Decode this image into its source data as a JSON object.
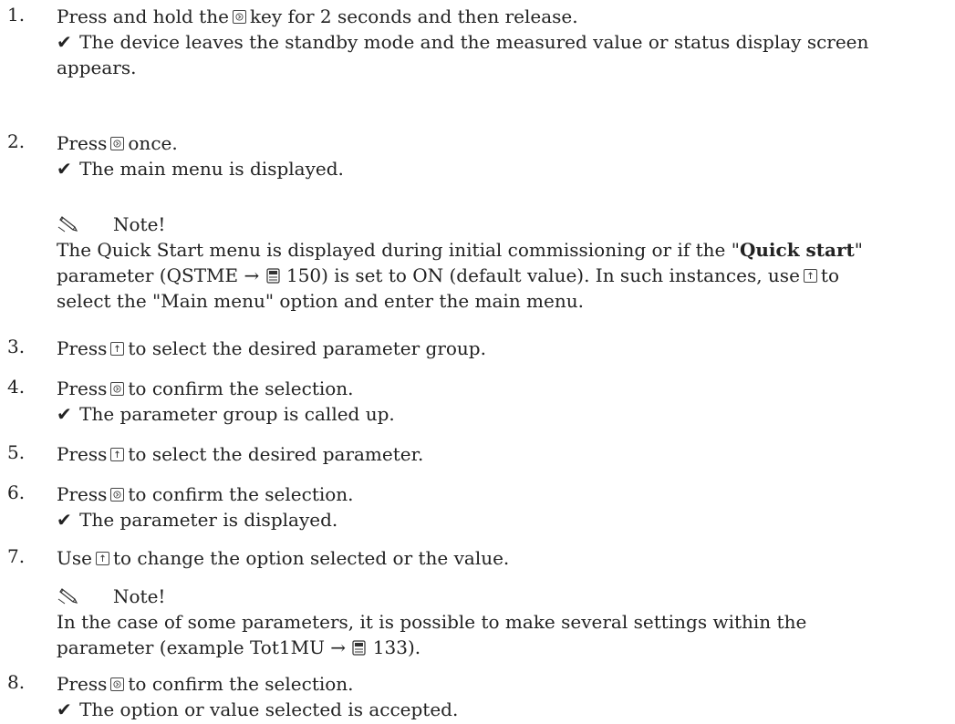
{
  "steps": [
    {
      "num": "1.",
      "a": "Press and hold the",
      "b": "key for 2 seconds and then release.",
      "result": "The device leaves the standby mode and the measured value or status display screen",
      "result2": "appears."
    },
    {
      "num": "2.",
      "a": "Press",
      "b": "once.",
      "result": "The main menu is displayed."
    },
    {
      "num": "3.",
      "a": "Press",
      "b": "to select the desired parameter group."
    },
    {
      "num": "4.",
      "a": "Press",
      "b": "to confirm the selection.",
      "result": "The parameter group is called up."
    },
    {
      "num": "5.",
      "a": "Press",
      "b": "to select the desired parameter."
    },
    {
      "num": "6.",
      "a": "Press",
      "b": "to confirm the selection.",
      "result": "The parameter is displayed."
    },
    {
      "num": "7.",
      "a": "Use",
      "b": "to change the option selected or the value."
    },
    {
      "num": "8.",
      "a": "Press",
      "b": "to confirm the selection.",
      "result": "The option or value selected is accepted."
    }
  ],
  "note1": {
    "title": "Note!",
    "l1a": "The Quick Start menu is displayed during initial commissioning or if the \"",
    "l1b": "Quick start",
    "l1c": "\"",
    "l2a": "parameter (QSTME →",
    "l2b": "150) is set to ON (default value). In such instances, use",
    "l2c": "to",
    "l3": "select the \"Main menu\" option and enter the main menu."
  },
  "note2": {
    "title": "Note!",
    "l1": "In the case of some parameters, it is possible to make several settings within the",
    "l2a": "parameter (example Tot1MU →",
    "l2b": "133)."
  },
  "icons": {
    "enter_key": "enter-key-icon",
    "up_key": "up-arrow-key-icon",
    "check": "check-icon",
    "note": "pencil-note-icon",
    "page_ref": "document-page-icon"
  }
}
